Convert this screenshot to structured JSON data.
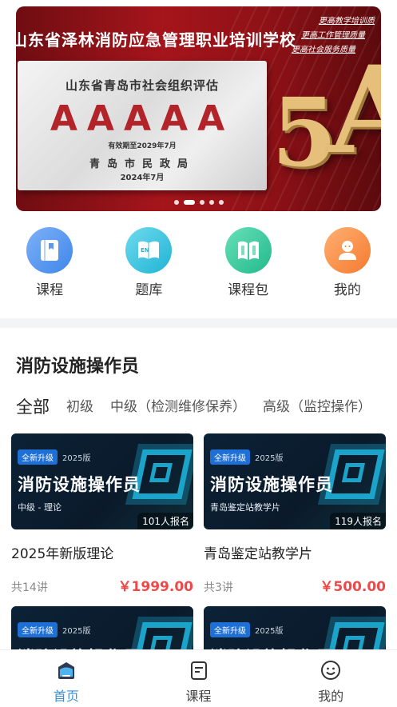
{
  "banner": {
    "title": "山东省泽林消防应急管理职业培训学校",
    "slogans": [
      "更高教学培训质",
      "更高工作管理质量",
      "更高社会服务质量"
    ],
    "plaque_org": "山东省青岛市社会组织评估",
    "plaque_grade": "AAAAA",
    "plaque_valid": "有效期至2029年7月",
    "plaque_issuer": "青岛市民政局",
    "plaque_date": "2024年7月",
    "big_text_digit": "5",
    "big_text_letter": "A",
    "slide_count": 5,
    "active_slide": 2
  },
  "quick_nav": [
    {
      "label": "课程",
      "icon": "book-icon"
    },
    {
      "label": "题库",
      "icon": "question-bank-icon"
    },
    {
      "label": "课程包",
      "icon": "course-package-icon"
    },
    {
      "label": "我的",
      "icon": "user-avatar-icon"
    }
  ],
  "section": {
    "title": "消防设施操作员",
    "tabs": [
      "全部",
      "初级",
      "中级（检测维修保养）",
      "高级（监控操作）"
    ],
    "active_tab": 0
  },
  "courses": [
    {
      "badge": "全新升级",
      "edition": "2025版",
      "thumb_title": "消防设施操作员",
      "thumb_sub": "中级 - 理论",
      "signups": "101人报名",
      "name": "2025年新版理论",
      "lessons": "共14讲",
      "price": "￥1999.00"
    },
    {
      "badge": "全新升级",
      "edition": "2025版",
      "thumb_title": "消防设施操作员",
      "thumb_sub": "青岛鉴定站教学片",
      "signups": "119人报名",
      "name": "青岛鉴定站教学片",
      "lessons": "共3讲",
      "price": "￥500.00"
    },
    {
      "badge": "全新升级",
      "edition": "2025版",
      "thumb_title": "消防设施操作员"
    },
    {
      "badge": "全新升级",
      "edition": "2025版",
      "thumb_title": "消防设施操作员"
    }
  ],
  "tabbar": [
    {
      "label": "首页",
      "icon": "home-icon",
      "active": true
    },
    {
      "label": "课程",
      "icon": "course-list-icon",
      "active": false
    },
    {
      "label": "我的",
      "icon": "smiley-face-icon",
      "active": false
    }
  ],
  "colors": {
    "accent": "#3a8fd9",
    "price": "#f04848",
    "banner_red": "#a5151b"
  }
}
